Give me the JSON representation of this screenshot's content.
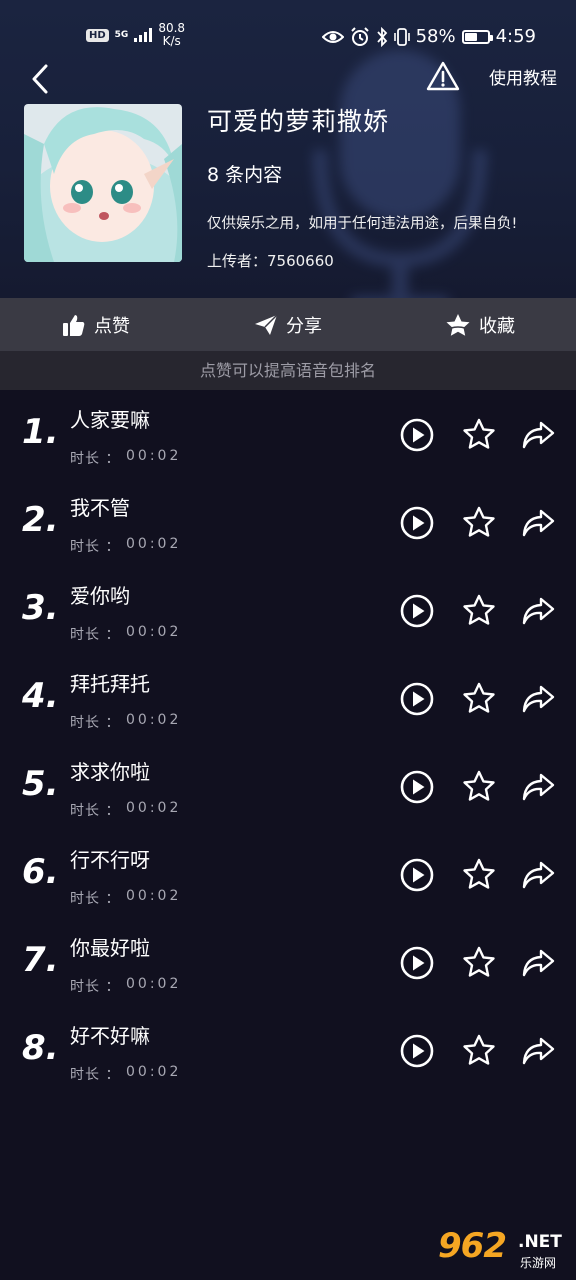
{
  "status_bar": {
    "hd": "HD",
    "network": "5G",
    "speed_value": "80.8",
    "speed_unit": "K/s",
    "battery_percent": "58%",
    "battery_level": 0.58,
    "time": "4:59"
  },
  "header": {
    "tutorial_label": "使用教程"
  },
  "album": {
    "title": "可爱的萝莉撒娇",
    "count": "8 条内容",
    "disclaimer": "仅供娱乐之用，如用于任何违法用途，后果自负!",
    "uploader": "上传者：7560660"
  },
  "actions": {
    "like": "点赞",
    "share": "分享",
    "collect": "收藏"
  },
  "hint": "点赞可以提高语音包排名",
  "duration_label": "时长 ：",
  "items": [
    {
      "num": "1.",
      "name": "人家要嘛",
      "duration": "00:02"
    },
    {
      "num": "2.",
      "name": "我不管",
      "duration": "00:02"
    },
    {
      "num": "3.",
      "name": "爱你哟",
      "duration": "00:02"
    },
    {
      "num": "4.",
      "name": "拜托拜托",
      "duration": "00:02"
    },
    {
      "num": "5.",
      "name": "求求你啦",
      "duration": "00:02"
    },
    {
      "num": "6.",
      "name": "行不行呀",
      "duration": "00:02"
    },
    {
      "num": "7.",
      "name": "你最好啦",
      "duration": "00:02"
    },
    {
      "num": "8.",
      "name": "好不好嘛",
      "duration": "00:02"
    }
  ],
  "watermark": {
    "main": "962",
    "net": ".NET",
    "sub": "乐游网"
  },
  "icons": {
    "back": "chevron-left-icon",
    "warning": "warning-triangle-icon",
    "like": "thumbs-up-icon",
    "share": "paper-plane-icon",
    "collect": "star-icon",
    "play": "play-circle-icon",
    "favorite": "star-outline-icon",
    "forward": "share-arrow-icon"
  },
  "colors": {
    "background": "#11101f",
    "hero": "#1b2440",
    "action_bar": "#3a3a44",
    "hint_bar": "#27262f",
    "watermark": "#f5a623"
  }
}
